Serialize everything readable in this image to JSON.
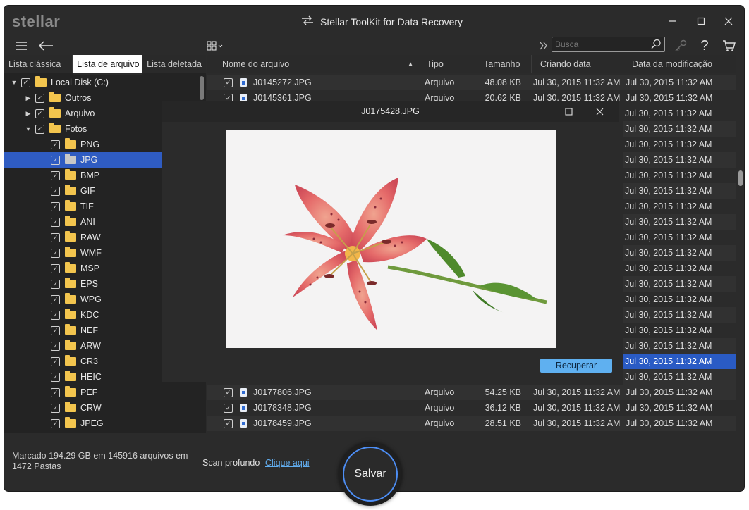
{
  "window": {
    "logo": "stellar",
    "title": "Stellar ToolKit for Data Recovery"
  },
  "toolbar": {
    "search_placeholder": "Busca"
  },
  "tabs": [
    "Lista clássica",
    "Lista de arquivo",
    "Lista deletada"
  ],
  "tree": [
    {
      "label": "Local Disk (C:)",
      "caret": "▼",
      "level": 0
    },
    {
      "label": "Outros",
      "caret": "▶",
      "level": 1
    },
    {
      "label": "Arquivo",
      "caret": "▶",
      "level": 1
    },
    {
      "label": "Fotos",
      "caret": "▼",
      "level": 1
    },
    {
      "label": "PNG",
      "level": 2
    },
    {
      "label": "JPG",
      "level": 2,
      "selected": true
    },
    {
      "label": "BMP",
      "level": 2
    },
    {
      "label": "GIF",
      "level": 2
    },
    {
      "label": "TIF",
      "level": 2
    },
    {
      "label": "ANI",
      "level": 2
    },
    {
      "label": "RAW",
      "level": 2
    },
    {
      "label": "WMF",
      "level": 2
    },
    {
      "label": "MSP",
      "level": 2
    },
    {
      "label": "EPS",
      "level": 2
    },
    {
      "label": "WPG",
      "level": 2
    },
    {
      "label": "KDC",
      "level": 2
    },
    {
      "label": "NEF",
      "level": 2
    },
    {
      "label": "ARW",
      "level": 2
    },
    {
      "label": "CR3",
      "level": 2
    },
    {
      "label": "HEIC",
      "level": 2
    },
    {
      "label": "PEF",
      "level": 2
    },
    {
      "label": "CRW",
      "level": 2
    },
    {
      "label": "JPEG",
      "level": 2
    }
  ],
  "columns": [
    "Nome do arquivo",
    "Tipo",
    "Tamanho",
    "Criando data",
    "Data da modificação"
  ],
  "files_top": [
    {
      "name": "J0145272.JPG",
      "type": "Arquivo",
      "size": "48.08 KB",
      "created": "Jul 30, 2015 11:32 AM",
      "modified": "Jul 30, 2015 11:32 AM"
    },
    {
      "name": "J0145361.JPG",
      "type": "Arquivo",
      "size": "20.62 KB",
      "created": "Jul 30, 2015 11:32 AM",
      "modified": "Jul 30, 2015 11:32 AM"
    }
  ],
  "modified_hidden_rows": [
    "Jul 30, 2015 11:32 AM",
    "Jul 30, 2015 11:32 AM",
    "Jul 30, 2015 11:32 AM",
    "Jul 30, 2015 11:32 AM",
    "Jul 30, 2015 11:32 AM",
    "Jul 30, 2015 11:32 AM",
    "Jul 30, 2015 11:32 AM",
    "Jul 30, 2015 11:32 AM",
    "Jul 30, 2015 11:32 AM",
    "Jul 30, 2015 11:32 AM",
    "Jul 30, 2015 11:32 AM",
    "Jul 30, 2015 11:32 AM",
    "Jul 30, 2015 11:32 AM",
    "Jul 30, 2015 11:32 AM",
    "Jul 30, 2015 11:32 AM",
    "Jul 30, 2015 11:32 AM",
    "Jul 30, 2015 11:32 AM",
    "Jul 30, 2015 11:32 AM"
  ],
  "files_bottom": [
    {
      "name": "J0177806.JPG",
      "type": "Arquivo",
      "size": "54.25 KB",
      "created": "Jul 30, 2015 11:32 AM",
      "modified": "Jul 30, 2015 11:32 AM"
    },
    {
      "name": "J0178348.JPG",
      "type": "Arquivo",
      "size": "36.12 KB",
      "created": "Jul 30, 2015 11:32 AM",
      "modified": "Jul 30, 2015 11:32 AM"
    },
    {
      "name": "J0178459.JPG",
      "type": "Arquivo",
      "size": "28.51 KB",
      "created": "Jul 30, 2015 11:32 AM",
      "modified": "Jul 30, 2015 11:32 AM"
    }
  ],
  "preview": {
    "title": "J0175428.JPG",
    "recover_label": "Recuperar"
  },
  "footer": {
    "status": "Marcado 194.29 GB em 145916 arquivos em 1472 Pastas",
    "deep_scan": "Scan profundo",
    "deep_scan_link": "Clique aqui",
    "save_label": "Salvar"
  },
  "colors": {
    "accent": "#2f5cc2",
    "selection": "#2a5bc4",
    "link": "#62aef0",
    "recover_button": "#5fb0f0",
    "folder": "#f3c54e"
  }
}
